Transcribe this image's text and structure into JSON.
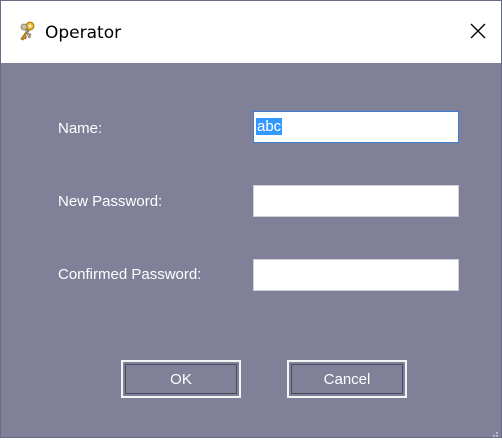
{
  "window": {
    "title": "Operator",
    "icon": "keys-icon",
    "close_icon": "close-icon"
  },
  "form": {
    "name_label": "Name:",
    "name_value": "abc",
    "new_password_label": "New Password:",
    "new_password_value": "",
    "confirmed_password_label": "Confirmed Password:",
    "confirmed_password_value": ""
  },
  "buttons": {
    "ok_label": "OK",
    "cancel_label": "Cancel"
  },
  "colors": {
    "client_background": "#808099",
    "selection": "#3399ff",
    "label_text": "#ffffff"
  }
}
